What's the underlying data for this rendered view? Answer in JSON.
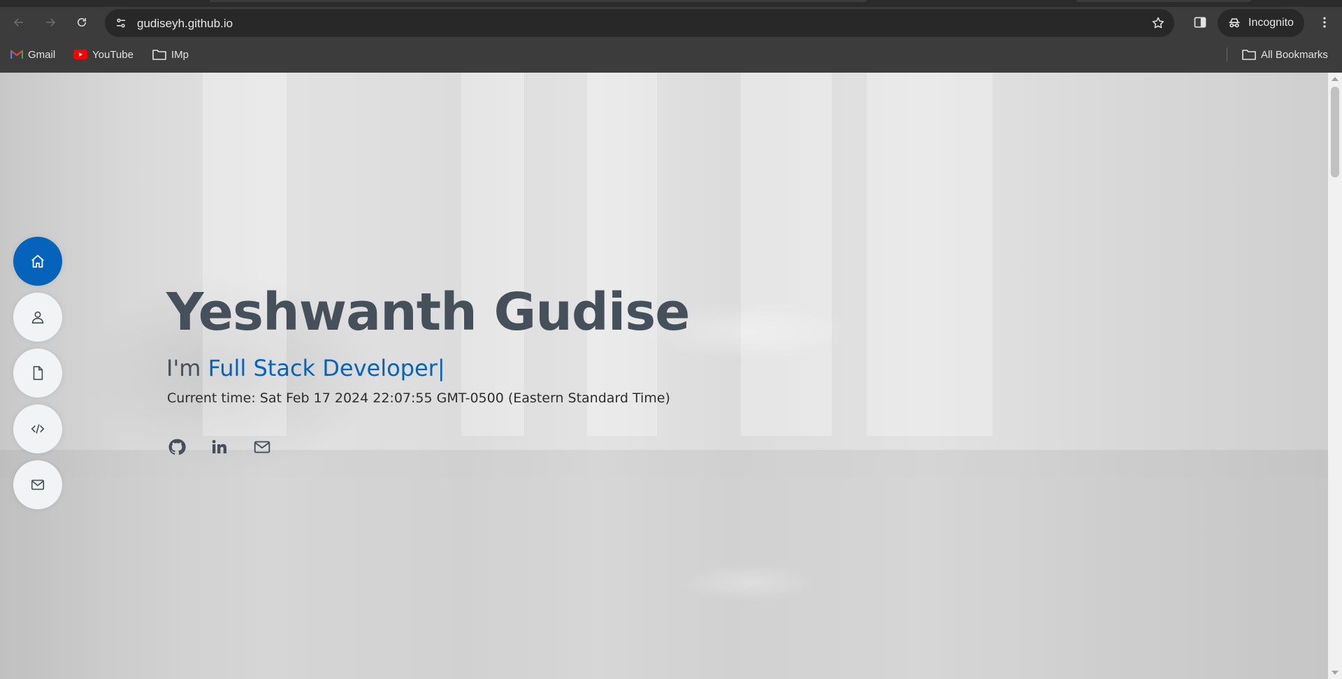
{
  "browser": {
    "url": "gudiseyh.github.io",
    "incognito_label": "Incognito",
    "bookmarks": [
      {
        "label": "Gmail",
        "icon": "gmail-icon"
      },
      {
        "label": "YouTube",
        "icon": "youtube-icon"
      },
      {
        "label": "IMp",
        "icon": "folder-icon"
      }
    ],
    "all_bookmarks_label": "All Bookmarks"
  },
  "side_nav": [
    {
      "name": "home",
      "icon": "home-icon",
      "active": true
    },
    {
      "name": "about",
      "icon": "person-icon",
      "active": false
    },
    {
      "name": "resume",
      "icon": "file-icon",
      "active": false
    },
    {
      "name": "projects",
      "icon": "code-icon",
      "active": false
    },
    {
      "name": "contact",
      "icon": "envelope-icon",
      "active": false
    }
  ],
  "hero": {
    "name": "Yeshwanth Gudise",
    "prefix": "I'm ",
    "typed_text": "Full Stack Developer|",
    "current_time": "Current time: Sat Feb 17 2024 22:07:55 GMT-0500 (Eastern Standard Time)",
    "social": [
      "github-icon",
      "linkedin-icon",
      "envelope-icon"
    ]
  },
  "colors": {
    "accent": "#0563bb",
    "heading": "#45505b",
    "chrome_bg": "#3c3c3c",
    "omnibox_bg": "#282828"
  }
}
